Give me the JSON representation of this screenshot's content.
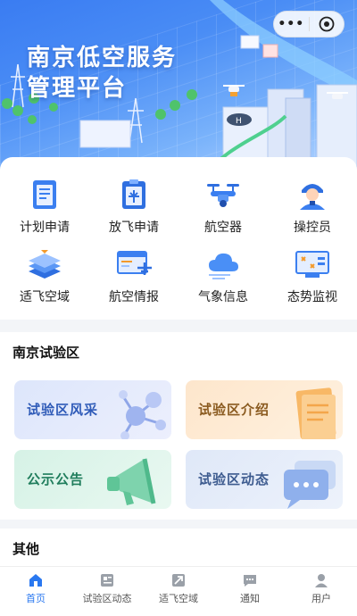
{
  "hero": {
    "title_line1": "南京低空服务",
    "title_line2": "管理平台",
    "capsule_more": "•••"
  },
  "menu": {
    "items": [
      {
        "label": "计划申请",
        "icon": "clipboard-plan-icon"
      },
      {
        "label": "放飞申请",
        "icon": "flight-application-icon"
      },
      {
        "label": "航空器",
        "icon": "drone-icon"
      },
      {
        "label": "操控员",
        "icon": "operator-icon"
      },
      {
        "label": "适飞空域",
        "icon": "airspace-layers-icon"
      },
      {
        "label": "航空情报",
        "icon": "aviation-info-icon"
      },
      {
        "label": "气象信息",
        "icon": "weather-cloud-icon"
      },
      {
        "label": "态势监视",
        "icon": "situation-monitor-icon"
      }
    ]
  },
  "section": {
    "title": "南京试验区",
    "tiles": [
      {
        "label": "试验区风采",
        "color": "#2f5bb8"
      },
      {
        "label": "试验区介绍",
        "color": "#8a5a1f"
      },
      {
        "label": "公示公告",
        "color": "#1f7d5c"
      },
      {
        "label": "试验区动态",
        "color": "#3d5b8f"
      }
    ]
  },
  "other": {
    "title": "其他"
  },
  "tabbar": {
    "items": [
      {
        "label": "首页",
        "icon": "home-icon",
        "active": true
      },
      {
        "label": "试验区动态",
        "icon": "news-icon",
        "active": false
      },
      {
        "label": "适飞空域",
        "icon": "airspace-icon",
        "active": false
      },
      {
        "label": "通知",
        "icon": "message-icon",
        "active": false
      },
      {
        "label": "用户",
        "icon": "user-icon",
        "active": false
      }
    ],
    "active_color": "#2a78f0",
    "inactive_color": "#9aa0a8"
  }
}
